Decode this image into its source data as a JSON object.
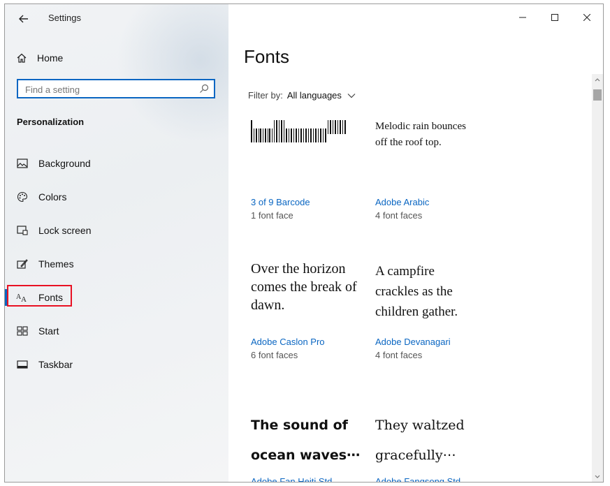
{
  "app": {
    "title": "Settings"
  },
  "sidebar": {
    "home_label": "Home",
    "search_placeholder": "Find a setting",
    "section_title": "Personalization",
    "items": [
      {
        "label": "Background",
        "icon": "image-icon"
      },
      {
        "label": "Colors",
        "icon": "palette-icon"
      },
      {
        "label": "Lock screen",
        "icon": "lock-screen-icon"
      },
      {
        "label": "Themes",
        "icon": "themes-icon"
      },
      {
        "label": "Fonts",
        "icon": "fonts-icon",
        "selected": true
      },
      {
        "label": "Start",
        "icon": "start-icon"
      },
      {
        "label": "Taskbar",
        "icon": "taskbar-icon"
      }
    ]
  },
  "main": {
    "title": "Fonts",
    "filter": {
      "label": "Filter by:",
      "value": "All languages"
    },
    "fonts": [
      {
        "preview": "",
        "name": "3 of 9 Barcode",
        "faces": "1 font face"
      },
      {
        "preview": "Melodic rain bounces off the roof top.",
        "name": "Adobe Arabic",
        "faces": "4 font faces"
      },
      {
        "preview": "Over the horizon comes the break of dawn.",
        "name": "Adobe Caslon Pro",
        "faces": "6 font faces"
      },
      {
        "preview": "A campfire crackles as the children gather.",
        "name": "Adobe Devanagari",
        "faces": "4 font faces"
      },
      {
        "preview": "The sound of ocean waves⋯",
        "name": "Adobe Fan Heiti Std",
        "faces": ""
      },
      {
        "preview": "They waltzed gracefully⋯",
        "name": "Adobe Fangsong Std",
        "faces": ""
      }
    ]
  },
  "colors": {
    "accent": "#0a66c2",
    "highlight": "#e81123"
  }
}
